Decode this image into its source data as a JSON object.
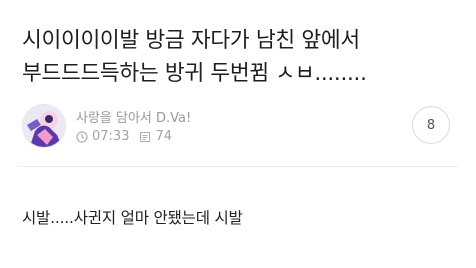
{
  "post": {
    "title": "시이이이이발 방금 자다가 남친 앞에서 부드드드득하는 방귀 두번뀜 ㅅㅂ........",
    "author": "사랑을 담아서 D.Va!",
    "time": "07:33",
    "views": "74",
    "comment_count": "8",
    "body": "시발.....사귄지 얼마 안됐는데 시발"
  },
  "colors": {
    "avatar_bg": "#e9e4f2",
    "avatar_accent": "#5a3aa8",
    "avatar_pink": "#f29ad0"
  }
}
